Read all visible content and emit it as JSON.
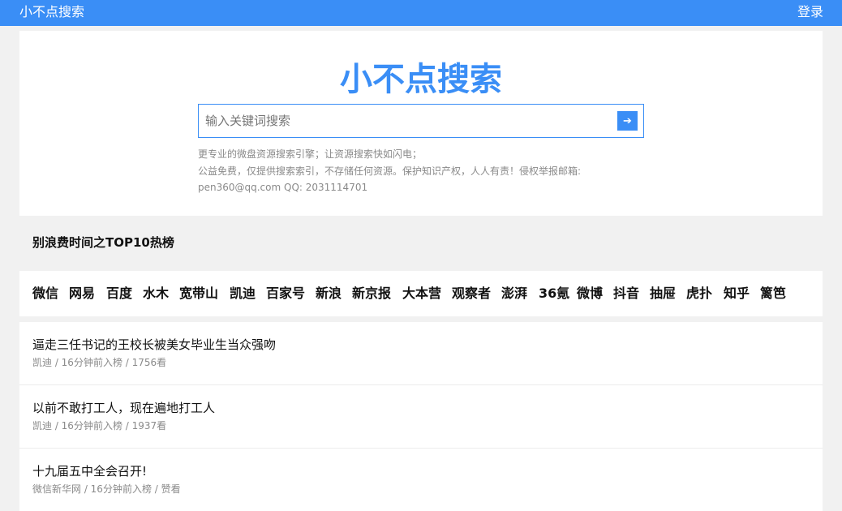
{
  "header": {
    "brand": "小不点搜索",
    "login_label": "登录"
  },
  "hero": {
    "logo": "小不点搜索",
    "search_placeholder": "输入关键词搜索",
    "search_value": "",
    "search_button": "➔",
    "notes": [
      "更专业的微盘资源搜索引擎；让资源搜索快如闪电；",
      "公益免费，仅提供搜索索引，不存储任何资源。保护知识产权，人人有责！侵权举报邮箱:",
      "pen360@qq.com QQ: 2031114701"
    ]
  },
  "section": {
    "title": "别浪费时间之TOP10热榜"
  },
  "sources": [
    "微信",
    "网易",
    "百度",
    "水木",
    "宽带山",
    "凯迪",
    "百家号",
    "新浪",
    "新京报",
    "大本营",
    "观察者",
    "澎湃",
    "36氪",
    "微博",
    "抖音",
    "抽屉",
    "虎扑",
    "知乎",
    "篱笆"
  ],
  "items": [
    {
      "title": "逼走三任书记的王校长被美女毕业生当众强吻",
      "meta": "凯迪 / 16分钟前入榜 / 1756看"
    },
    {
      "title": "以前不敢打工人，现在遍地打工人",
      "meta": "凯迪 / 16分钟前入榜 / 1937看"
    },
    {
      "title": "十九届五中全会召开!",
      "meta": "微信新华网 / 16分钟前入榜 / 赞看"
    }
  ],
  "colors": {
    "accent": "#3a8ef6",
    "page_background": "#f1f1f1"
  }
}
